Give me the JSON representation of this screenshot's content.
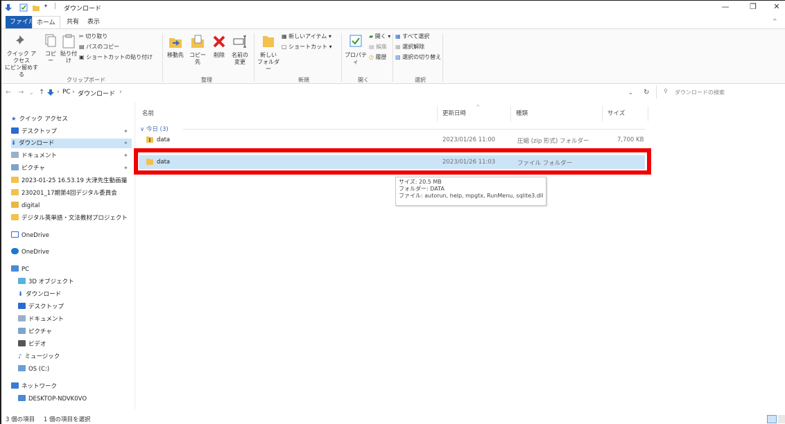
{
  "window": {
    "title": "ダウンロード",
    "minimize_icon": "minimize-icon",
    "maximize_icon": "maximize-icon",
    "close_icon": "close-icon"
  },
  "ribbon_tabs": [
    "ファイル",
    "ホーム",
    "共有",
    "表示"
  ],
  "ribbon": {
    "clipboard": {
      "pin_label_1": "クイック アクセス",
      "pin_label_2": "にピン留めする",
      "copy": "コピー",
      "paste": "貼り付け",
      "cut": "切り取り",
      "copy_path": "パスのコピー",
      "paste_shortcut": "ショートカットの貼り付け",
      "group": "クリップボード"
    },
    "organize": {
      "move_to": "移動先",
      "copy_to": "コピー先",
      "delete": "削除",
      "rename_1": "名前の",
      "rename_2": "変更",
      "group": "整理"
    },
    "new": {
      "new_folder_1": "新しい",
      "new_folder_2": "フォルダー",
      "new_item": "新しいアイテム ▾",
      "easy_access": "ショートカット ▾",
      "group": "新規"
    },
    "open": {
      "properties": "プロパティ",
      "open": "開く ▾",
      "edit": "編集",
      "history": "履歴",
      "group": "開く"
    },
    "select": {
      "select_all": "すべて選択",
      "select_none": "選択解除",
      "invert": "選択の切り替え",
      "group": "選択"
    }
  },
  "address": {
    "crumbs": [
      "PC",
      "ダウンロード"
    ],
    "search_placeholder": "ダウンロードの検索"
  },
  "nav_pane": {
    "quick_access": "クイック アクセス",
    "items": [
      "デスクトップ",
      "ダウンロード",
      "ドキュメント",
      "ピクチャ",
      "2023-01-25 16.53.19 大津先生動画撮",
      "230201_17期第4回デジタル委員会",
      "digital",
      "デジタル英単語・文法教材プロジェクト"
    ],
    "onedrive_1": "OneDrive",
    "onedrive_2": "OneDrive",
    "pc": "PC",
    "pc_items": [
      "3D オブジェクト",
      "ダウンロード",
      "デスクトップ",
      "ドキュメント",
      "ピクチャ",
      "ビデオ",
      "ミュージック",
      "OS (C:)"
    ],
    "network": "ネットワーク",
    "network_items": [
      "DESKTOP-NDVK0VO"
    ]
  },
  "columns": {
    "name": "名前",
    "modified": "更新日時",
    "type": "種類",
    "size": "サイズ"
  },
  "group_header": "今日 (3)",
  "files": [
    {
      "name": "data",
      "modified": "2023/01/26 11:00",
      "type": "圧縮 (zip 形式) フォルダー",
      "size": "7,700 KB"
    },
    {
      "name": "data",
      "modified": "2023/01/26 11:03",
      "type": "ファイル フォルダー",
      "size": ""
    }
  ],
  "tooltip": {
    "line1": "サイズ: 20.5 MB",
    "line2": "フォルダー: DATA",
    "line3": "ファイル: autorun, help, mpgtx, RunMenu, sqlite3.dll, ..."
  },
  "status": {
    "items": "3 個の項目",
    "selected": "1 個の項目を選択"
  },
  "colors": {
    "file_tab": "#1a5fb4",
    "selection": "#cce4f7",
    "highlight_box": "#f20000",
    "folder": "#f2c14e"
  }
}
